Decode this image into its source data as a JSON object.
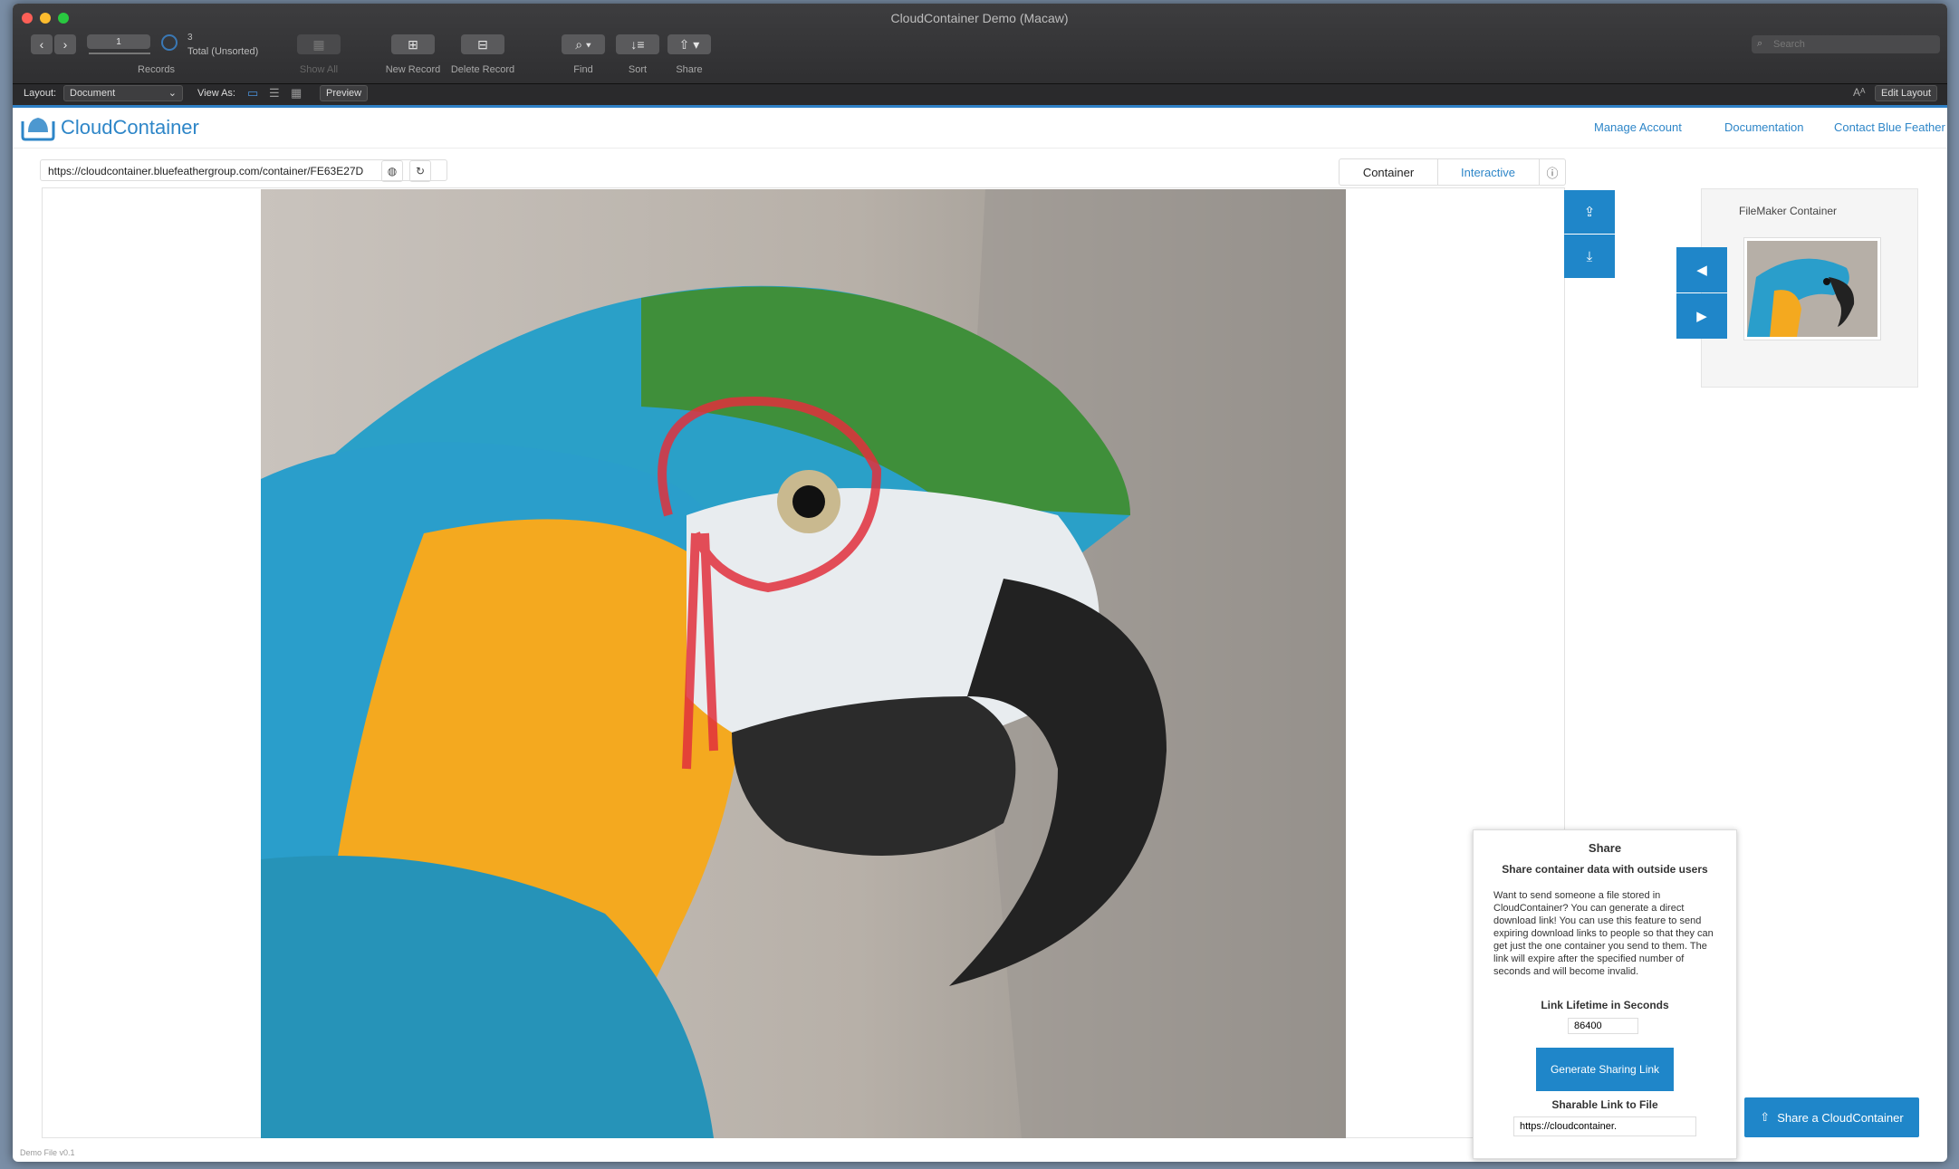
{
  "window": {
    "title": "CloudContainer Demo (Macaw)"
  },
  "toolbar": {
    "record_current": "1",
    "record_total": "3",
    "record_status": "Total (Unsorted)",
    "records_label": "Records",
    "show_all": "Show All",
    "new_record": "New Record",
    "delete_record": "Delete Record",
    "find": "Find",
    "sort": "Sort",
    "share": "Share",
    "search_placeholder": "Search"
  },
  "layoutbar": {
    "layout_label": "Layout:",
    "layout_value": "Document",
    "view_as_label": "View As:",
    "preview": "Preview",
    "edit_layout": "Edit Layout"
  },
  "header": {
    "brand": "CloudContainer",
    "links": [
      "Manage Account",
      "Documentation",
      "Contact Blue Feather"
    ]
  },
  "viewer": {
    "url": "https://cloudcontainer.bluefeathergroup.com/container/FE63E27D",
    "tabs": [
      "Container",
      "Interactive"
    ],
    "active_tab": "Interactive"
  },
  "side": {
    "container_title": "FileMaker Container"
  },
  "share_popover": {
    "title": "Share",
    "subtitle": "Share container data with outside users",
    "body": "Want to send someone a file stored in CloudContainer? You can generate a direct download link! You can use this feature to send expiring download links to people so that they can get just the one container you send to them. The link will expire after the specified number of seconds and will become invalid.",
    "lifetime_label": "Link Lifetime in Seconds",
    "lifetime_value": "86400",
    "generate_button": "Generate Sharing Link",
    "sharable_label": "Sharable Link to File",
    "sharable_value": "https://cloudcontainer."
  },
  "share_button": "Share a CloudContainer",
  "status": {
    "footer": "Demo File v0.1"
  },
  "colors": {
    "accent": "#1f86c9",
    "link": "#2e86c8",
    "toolbar": "#333335"
  }
}
